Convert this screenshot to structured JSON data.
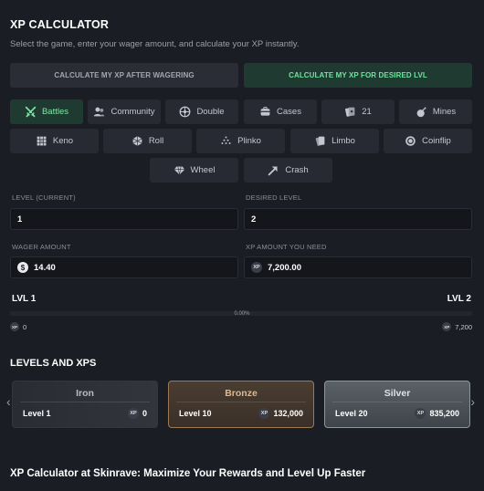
{
  "header": {
    "title": "XP CALCULATOR",
    "subtitle": "Select the game, enter your wager amount, and calculate your XP instantly."
  },
  "mode_tabs": [
    {
      "label": "CALCULATE MY XP AFTER WAGERING",
      "active": false
    },
    {
      "label": "CALCULATE MY XP FOR DESIRED LVL",
      "active": true
    }
  ],
  "games": [
    {
      "label": "Battles",
      "icon": "swords-icon",
      "active": true
    },
    {
      "label": "Community",
      "icon": "users-icon",
      "active": false
    },
    {
      "label": "Double",
      "icon": "roulette-wheel-icon",
      "active": false
    },
    {
      "label": "Cases",
      "icon": "case-box-icon",
      "active": false
    },
    {
      "label": "21",
      "icon": "playing-cards-icon",
      "active": false
    },
    {
      "label": "Mines",
      "icon": "bomb-icon",
      "active": false
    },
    {
      "label": "Keno",
      "icon": "grid-icon",
      "active": false
    },
    {
      "label": "Roll",
      "icon": "dice-roll-icon",
      "active": false
    },
    {
      "label": "Plinko",
      "icon": "plinko-pyramid-icon",
      "active": false
    },
    {
      "label": "Limbo",
      "icon": "limbo-cards-icon",
      "active": false
    },
    {
      "label": "Coinflip",
      "icon": "coinflip-icon",
      "active": false
    },
    {
      "label": "Wheel",
      "icon": "diamond-icon",
      "active": false
    },
    {
      "label": "Crash",
      "icon": "crash-arrow-icon",
      "active": false
    }
  ],
  "inputs": {
    "level_current": {
      "label": "LEVEL (CURRENT)",
      "value": "1"
    },
    "desired_level": {
      "label": "DESIRED LEVEL",
      "value": "2"
    },
    "wager_amount": {
      "label": "WAGER AMOUNT",
      "value": "14.40",
      "currency_icon": "dollar-coin-icon"
    },
    "xp_needed": {
      "label": "XP AMOUNT YOU NEED",
      "value": "7,200.00",
      "currency_icon": "xp-coin-icon"
    }
  },
  "progress": {
    "start_label": "LVL 1",
    "end_label": "LVL 2",
    "percent_text": "0.00%",
    "percent_value": 0,
    "start_xp": "0",
    "end_xp": "7,200",
    "xp_badge": "XP",
    "fill_color": "#4fd38a"
  },
  "levels_section": {
    "title": "LEVELS AND XPS",
    "prev_arrow": "‹",
    "next_arrow": "›",
    "cards": [
      {
        "name": "Iron",
        "level": "Level 1",
        "xp": "0"
      },
      {
        "name": "Bronze",
        "level": "Level 10",
        "xp": "132,000"
      },
      {
        "name": "Silver",
        "level": "Level 20",
        "xp": "835,200"
      }
    ]
  },
  "footer": {
    "title": "XP Calculator at Skinrave: Maximize Your Rewards and Level Up Faster"
  },
  "colors": {
    "background": "#1b1d24",
    "accent_green": "#6fe39f",
    "active_bg": "#1f3a31",
    "bronze": "#e0b68a",
    "silver": "#dfe3e8"
  }
}
